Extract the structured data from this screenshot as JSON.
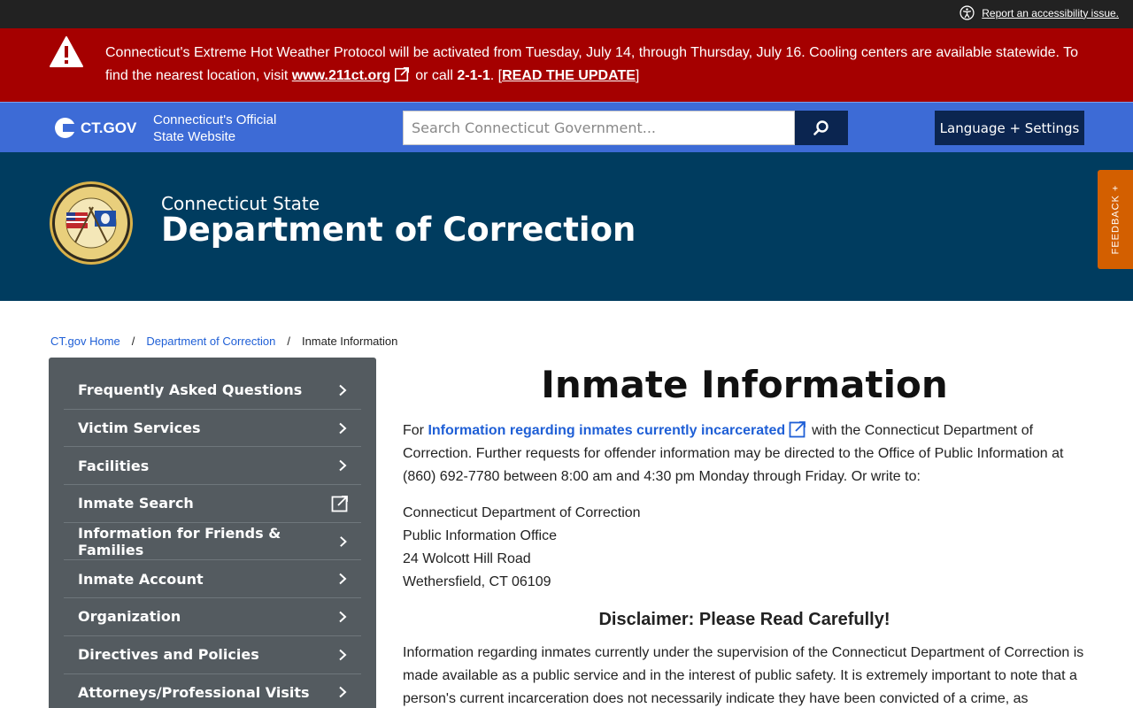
{
  "utility": {
    "accessibility_label": "Report an accessibility issue."
  },
  "alert": {
    "text_before": "Connecticut's Extreme Hot Weather Protocol will be activated from Tuesday, July 14, through Thursday, July 16. Cooling centers are available statewide. To find the nearest location, visit ",
    "link": "www.211ct.org",
    "text_mid": "or call ",
    "phone": "2-1-1",
    "text_after": ". [",
    "update_link": "READ THE UPDATE",
    "text_end": "]"
  },
  "ctgov": {
    "logo_text": "CT.GOV",
    "tagline_1": "Connecticut's Official",
    "tagline_2": "State Website",
    "search_placeholder": "Search Connecticut Government...",
    "language_button": "Language + Settings"
  },
  "department": {
    "subtitle": "Connecticut State",
    "title": "Department of Correction"
  },
  "feedback_label": "FEEDBACK +",
  "breadcrumb": {
    "home": "CT.gov Home",
    "dept": "Department of Correction",
    "current": "Inmate Information",
    "separator": "/"
  },
  "sidebar": {
    "items": [
      {
        "label": "Frequently Asked Questions",
        "icon": "chevron-right-icon"
      },
      {
        "label": "Victim Services",
        "icon": "chevron-right-icon"
      },
      {
        "label": "Facilities",
        "icon": "chevron-right-icon"
      },
      {
        "label": "Inmate Search",
        "icon": "external-link-icon"
      },
      {
        "label": "Information for Friends & Families",
        "icon": "chevron-right-icon"
      },
      {
        "label": "Inmate Account",
        "icon": "chevron-right-icon"
      },
      {
        "label": "Organization",
        "icon": "chevron-right-icon"
      },
      {
        "label": "Directives and Policies",
        "icon": "chevron-right-icon"
      },
      {
        "label": "Attorneys/Professional Visits",
        "icon": "chevron-right-icon"
      }
    ]
  },
  "main": {
    "title": "Inmate Information",
    "intro_prefix": "For ",
    "intro_link": "Information regarding inmates currently incarcerated",
    "intro_rest": "with the Connecticut Department of Correction. Further requests for offender information may be directed to the Office of Public Information at (860) 692-7780 between 8:00 am and 4:30 pm Monday through Friday.  Or write to:",
    "address": [
      "Connecticut Department of Correction",
      "Public Information Office",
      "24 Wolcott Hill Road",
      "Wethersfield, CT 06109"
    ],
    "disclaimer_title": "Disclaimer: Please Read Carefully!",
    "disclaimer_text": "Information regarding inmates currently under the supervision of the Connecticut Department of Correction is made available as a public service and in the interest of public safety. It is extremely important to note that a person's current incarceration does not necessarily indicate they have been convicted of a crime, as"
  }
}
